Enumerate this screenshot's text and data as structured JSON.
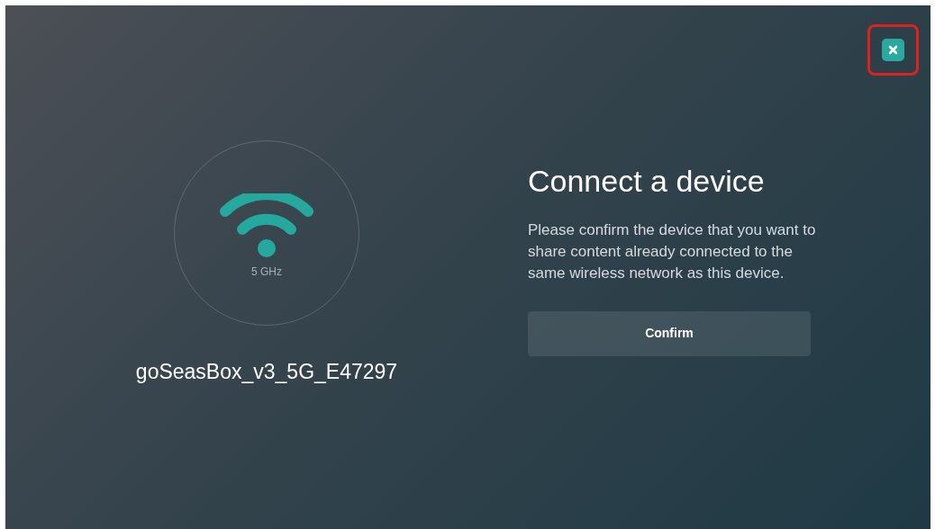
{
  "close_button": {
    "highlighted": true
  },
  "network": {
    "band": "5 GHz",
    "ssid": "goSeasBox_v3_5G_E47297"
  },
  "dialog": {
    "title": "Connect a device",
    "message": "Please confirm the device that you want to share content already connected to the same wireless network as this device.",
    "button": "Confirm"
  }
}
